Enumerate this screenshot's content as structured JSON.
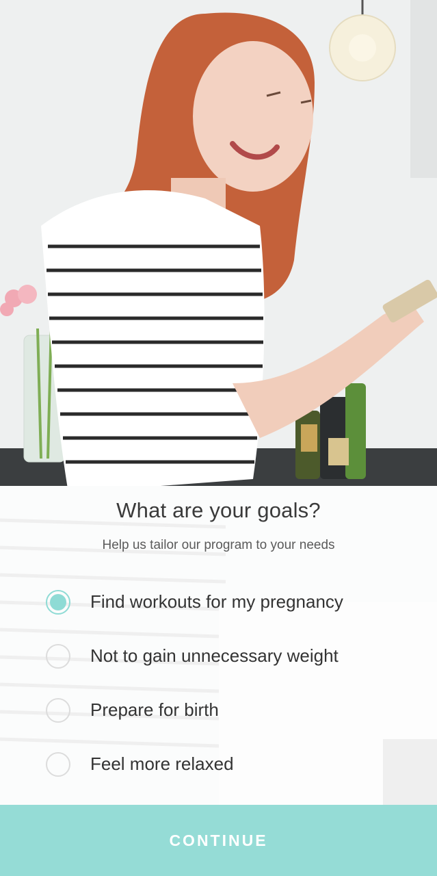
{
  "header": {
    "title": "What are your goals?",
    "subtitle": "Help us tailor our program to your needs"
  },
  "goals": {
    "selected_index": 0,
    "options": [
      {
        "label": "Find workouts for my pregnancy",
        "selected": true
      },
      {
        "label": "Not to gain unnecessary weight",
        "selected": false
      },
      {
        "label": "Prepare for birth",
        "selected": false
      },
      {
        "label": "Feel more relaxed",
        "selected": false
      }
    ]
  },
  "footer": {
    "continue_label": "CONTINUE"
  },
  "colors": {
    "accent": "#95dcd6",
    "radio_checked": "#8edbd5",
    "text": "#333333"
  },
  "background": {
    "icon": "photo-woman-striped-shirt"
  }
}
